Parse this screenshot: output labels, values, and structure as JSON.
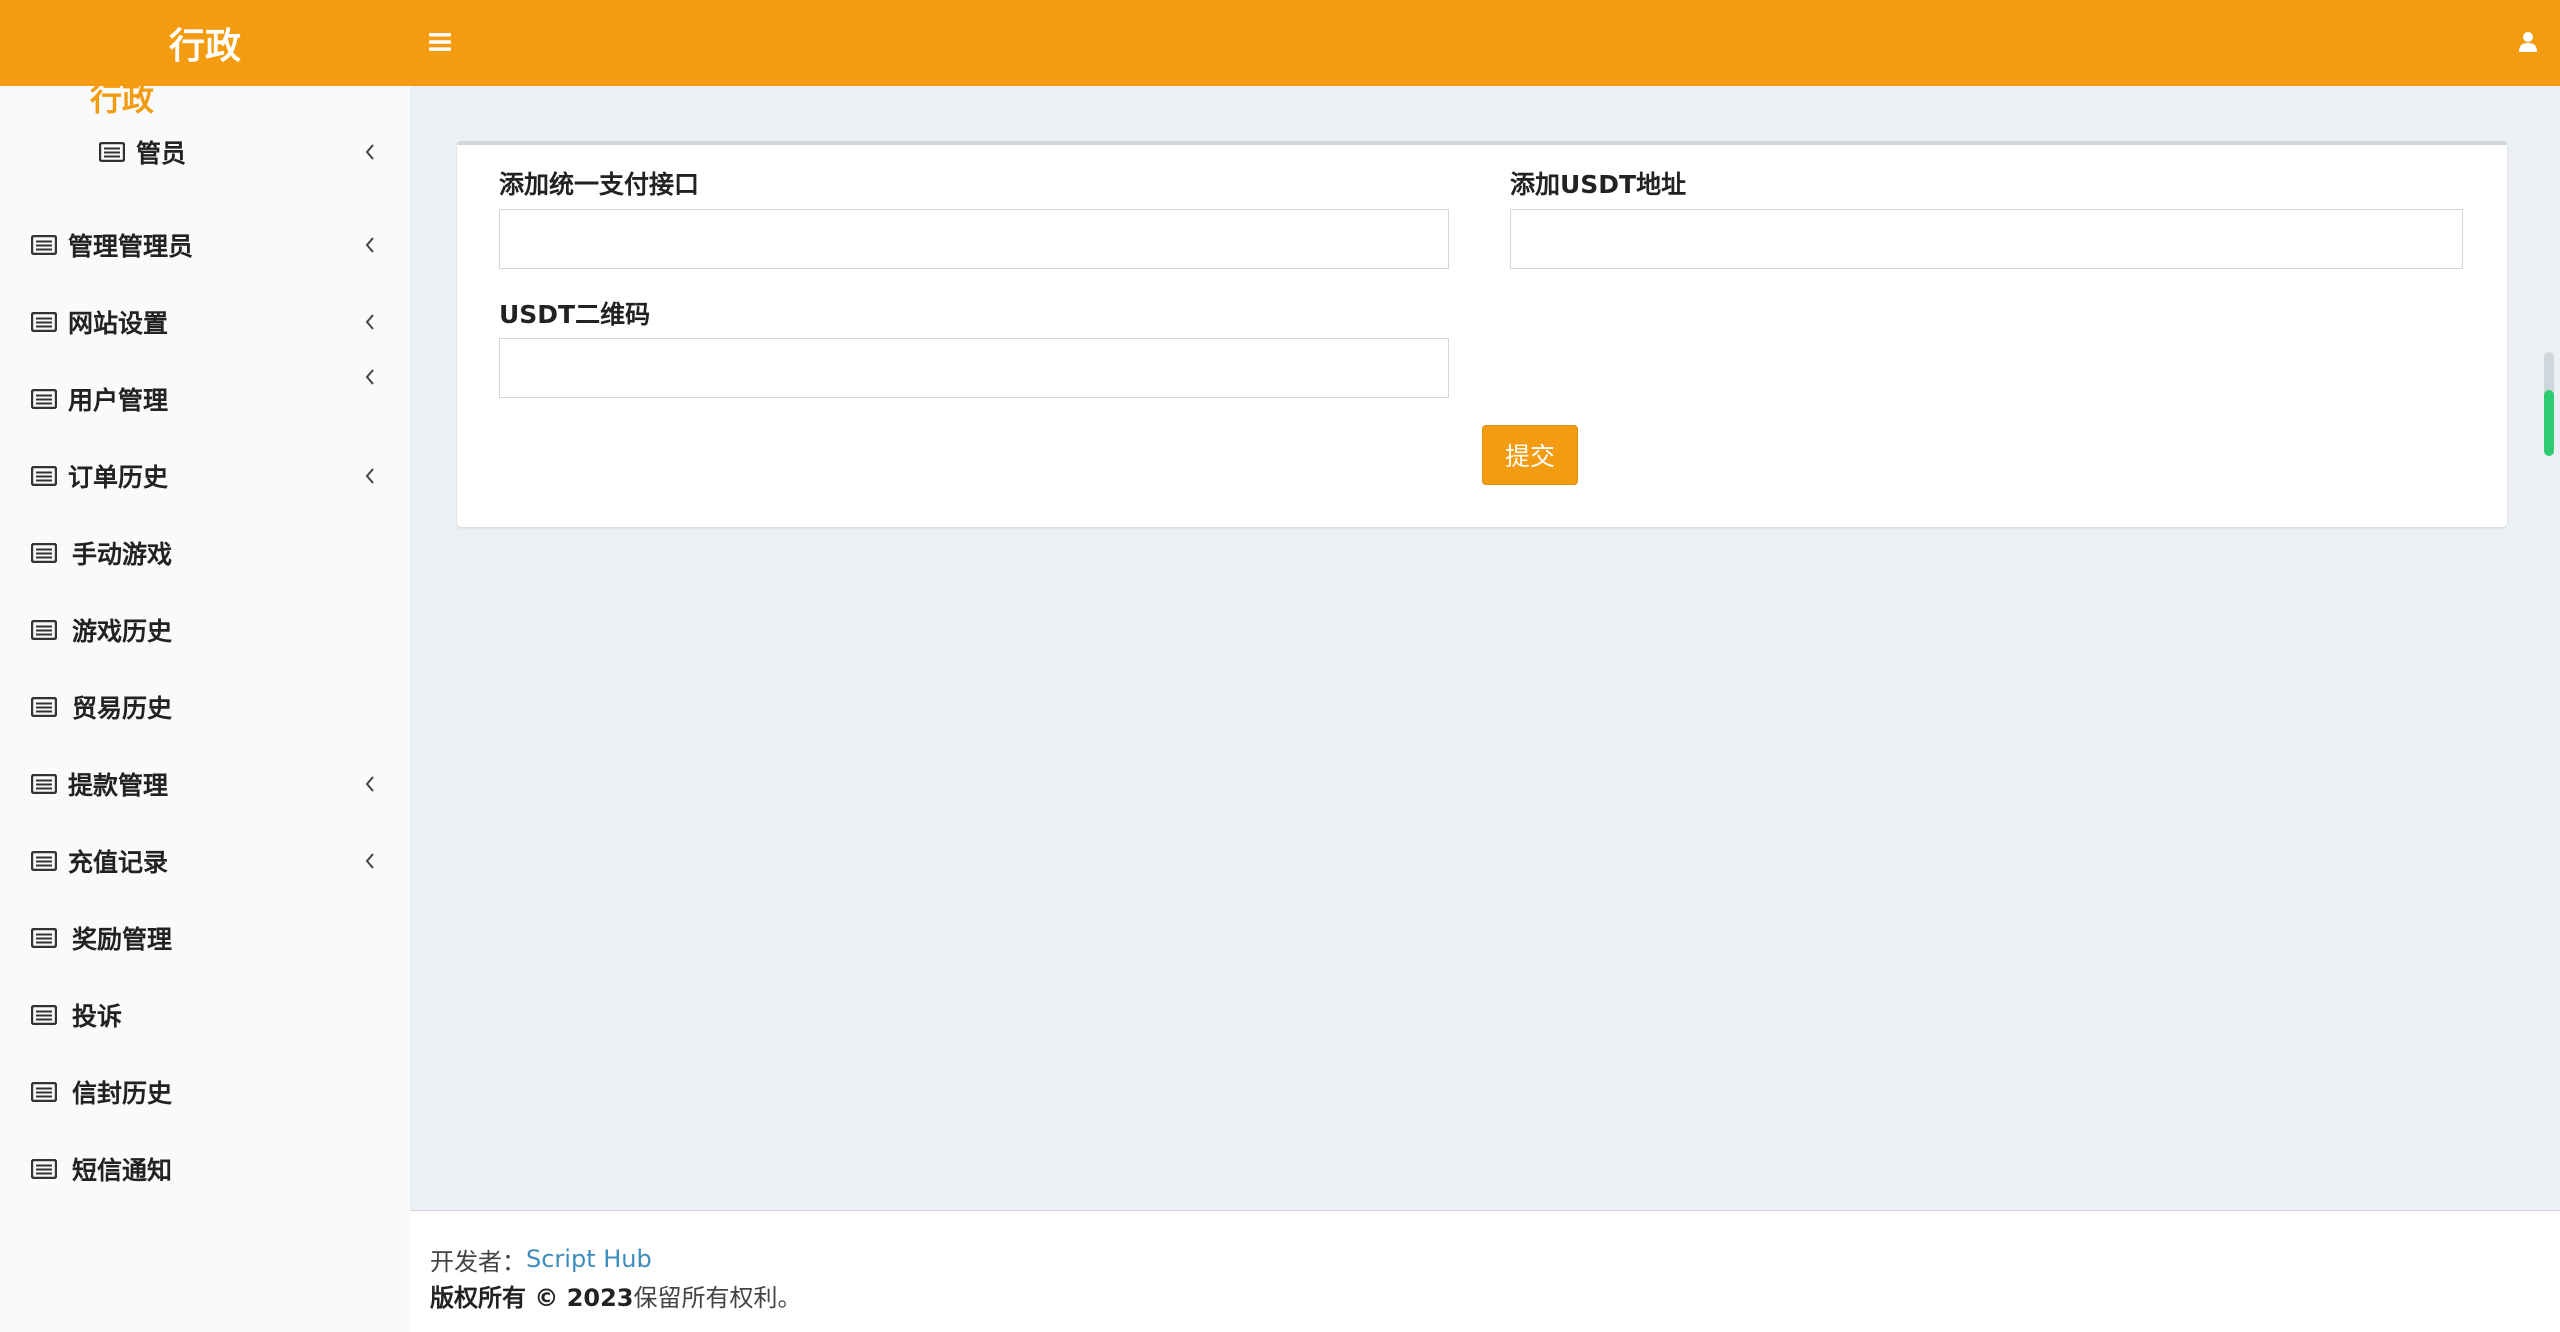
{
  "header": {
    "logo": "行政",
    "menu_icon": "hamburger-icon",
    "user_icon": "user-icon",
    "accent_color": "#f39c12"
  },
  "sidebar": {
    "peek_text": "行政",
    "items": [
      {
        "label": "管员",
        "icon": "list-icon",
        "chevron": true
      },
      {
        "label": "管理管理员",
        "icon": "list-icon",
        "chevron": true
      },
      {
        "label": "网站设置",
        "icon": "list-icon",
        "chevron": true
      },
      {
        "label": "用户管理",
        "icon": "list-icon",
        "chevron": true
      },
      {
        "label": "订单历史",
        "icon": "list-icon",
        "chevron": true
      },
      {
        "label": "手动游戏",
        "icon": "list-icon",
        "chevron": false
      },
      {
        "label": "游戏历史",
        "icon": "list-icon",
        "chevron": false
      },
      {
        "label": "贸易历史",
        "icon": "list-icon",
        "chevron": false
      },
      {
        "label": "提款管理",
        "icon": "list-icon",
        "chevron": true
      },
      {
        "label": "充值记录",
        "icon": "list-icon",
        "chevron": true
      },
      {
        "label": "奖励管理",
        "icon": "list-icon",
        "chevron": false
      },
      {
        "label": "投诉",
        "icon": "list-icon",
        "chevron": false
      },
      {
        "label": "信封历史",
        "icon": "list-icon",
        "chevron": false
      },
      {
        "label": "短信通知",
        "icon": "list-icon",
        "chevron": false
      }
    ]
  },
  "form": {
    "payment_api_label": "添加统一支付接口",
    "payment_api_value": "",
    "usdt_address_label": "添加USDT地址",
    "usdt_address_value": "",
    "usdt_qr_label": "USDT二维码",
    "usdt_qr_value": "",
    "submit_label": "提交"
  },
  "footer": {
    "developer_prefix": "开发者：",
    "developer_name": "Script Hub",
    "copyright_bold": "版权所有 © 2023",
    "copyright_rest": "保留所有权利。"
  }
}
